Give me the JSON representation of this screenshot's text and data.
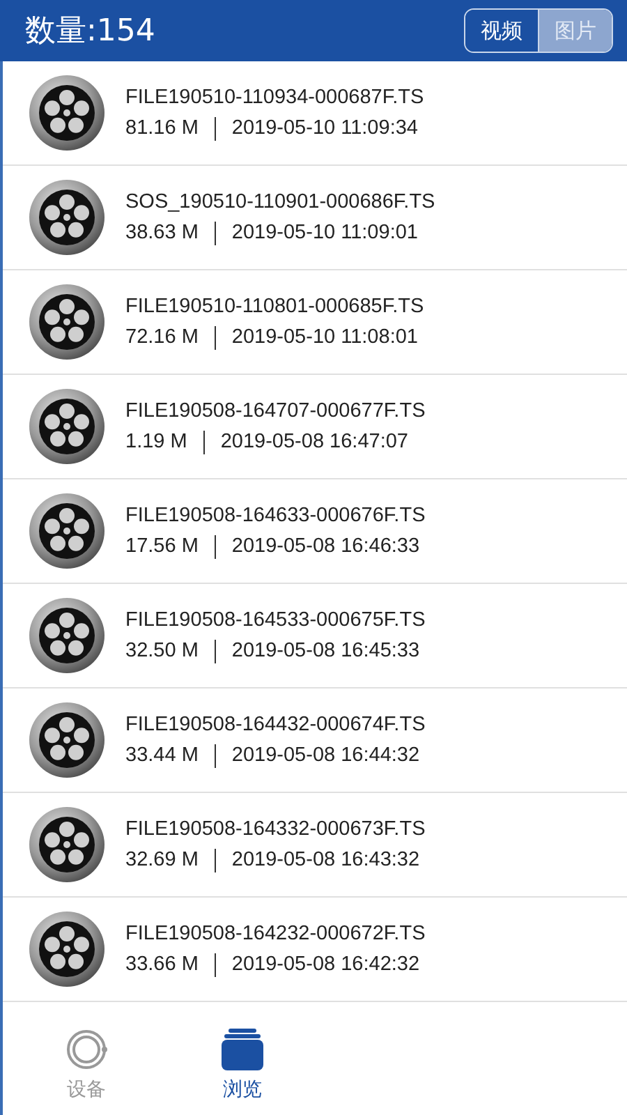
{
  "header": {
    "title": "数量:154",
    "toggle": [
      {
        "label": "视频",
        "selected": true
      },
      {
        "label": "图片",
        "selected": false
      }
    ]
  },
  "files": [
    {
      "name": "FILE190510-110934-000687F.TS",
      "size": "81.16 M",
      "time": "2019-05-10 11:09:34"
    },
    {
      "name": "SOS_190510-110901-000686F.TS",
      "size": "38.63 M",
      "time": "2019-05-10 11:09:01"
    },
    {
      "name": "FILE190510-110801-000685F.TS",
      "size": "72.16 M",
      "time": "2019-05-10 11:08:01"
    },
    {
      "name": "FILE190508-164707-000677F.TS",
      "size": "1.19 M",
      "time": "2019-05-08 16:47:07"
    },
    {
      "name": "FILE190508-164633-000676F.TS",
      "size": "17.56 M",
      "time": "2019-05-08 16:46:33"
    },
    {
      "name": "FILE190508-164533-000675F.TS",
      "size": "32.50 M",
      "time": "2019-05-08 16:45:33"
    },
    {
      "name": "FILE190508-164432-000674F.TS",
      "size": "33.44 M",
      "time": "2019-05-08 16:44:32"
    },
    {
      "name": "FILE190508-164332-000673F.TS",
      "size": "32.69 M",
      "time": "2019-05-08 16:43:32"
    },
    {
      "name": "FILE190508-164232-000672F.TS",
      "size": "33.66 M",
      "time": "2019-05-08 16:42:32"
    }
  ],
  "bottom_nav": [
    {
      "label": "设备",
      "kind": "device",
      "selected": false
    },
    {
      "label": "浏览",
      "kind": "browse",
      "selected": true
    }
  ]
}
